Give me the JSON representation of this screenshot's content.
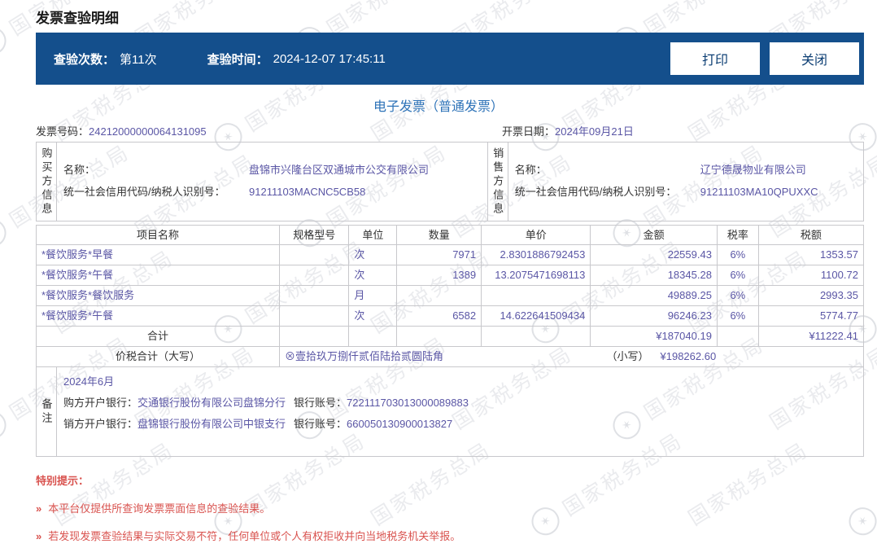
{
  "page_title": "发票查验明细",
  "query_bar": {
    "count_label": "查验次数：",
    "count_value": "第11次",
    "time_label": "查验时间：",
    "time_value": "2024-12-07 17:45:11",
    "print_button": "打印",
    "close_button": "关闭"
  },
  "invoice": {
    "type_title": "电子发票（普通发票）",
    "number_label": "发票号码：",
    "number": "24212000000064131095",
    "date_label": "开票日期：",
    "date": "2024年09月21日",
    "buyer": {
      "side_label": "购买方信息",
      "name_label": "名称：",
      "name": "盘锦市兴隆台区双通城市公交有限公司",
      "taxid_label": "统一社会信用代码/纳税人识别号：",
      "taxid": "91211103MACNC5CB58"
    },
    "seller": {
      "side_label": "销售方信息",
      "name_label": "名称：",
      "name": "辽宁德晟物业有限公司",
      "taxid_label": "统一社会信用代码/纳税人识别号：",
      "taxid": "91211103MA10QPUXXC"
    }
  },
  "items_table": {
    "headers": {
      "name": "项目名称",
      "spec": "规格型号",
      "unit": "单位",
      "qty": "数量",
      "price": "单价",
      "amount": "金额",
      "rate": "税率",
      "tax": "税额"
    },
    "rows": [
      {
        "name": "*餐饮服务*早餐",
        "spec": "",
        "unit": "次",
        "qty": "7971",
        "price": "2.8301886792453",
        "amount": "22559.43",
        "rate": "6%",
        "tax": "1353.57"
      },
      {
        "name": "*餐饮服务*午餐",
        "spec": "",
        "unit": "次",
        "qty": "1389",
        "price": "13.2075471698113",
        "amount": "18345.28",
        "rate": "6%",
        "tax": "1100.72"
      },
      {
        "name": "*餐饮服务*餐饮服务",
        "spec": "",
        "unit": "月",
        "qty": "",
        "price": "",
        "amount": "49889.25",
        "rate": "6%",
        "tax": "2993.35"
      },
      {
        "name": "*餐饮服务*午餐",
        "spec": "",
        "unit": "次",
        "qty": "6582",
        "price": "14.622641509434",
        "amount": "96246.23",
        "rate": "6%",
        "tax": "5774.77"
      }
    ],
    "total": {
      "label": "合计",
      "amount": "¥187040.19",
      "tax": "¥11222.41"
    },
    "tax_total": {
      "label": "价税合计（大写）",
      "uppercase": "⊗壹拾玖万捌仟贰佰陆拾贰圆陆角",
      "lowercase_label": "（小写）",
      "lowercase_value": "¥198262.60"
    },
    "remark": {
      "side_label": "备注",
      "line1": "2024年6月",
      "buyer_bank_label": "购方开户银行：",
      "buyer_bank": "交通银行股份有限公司盘锦分行",
      "buyer_acct_label": "银行账号：",
      "buyer_acct": "722111703013000089883",
      "seller_bank_label": "销方开户银行：",
      "seller_bank": "盘锦银行股份有限公司中银支行",
      "seller_acct_label": "银行账号：",
      "seller_acct": "660050130900013827"
    }
  },
  "notice": {
    "title": "特别提示：",
    "bullet": "»",
    "items": [
      "本平台仅提供所查询发票票面信息的查验结果。",
      "若发现发票查验结果与实际交易不符，任何单位或个人有权拒收并向当地税务机关举报。"
    ]
  },
  "watermark": {
    "text": "国家税务总局"
  },
  "colors": {
    "header_bar_blue": "#144f8c",
    "button_text_blue": "#0c3e73",
    "invoice_title_blue": "#2e73b8",
    "value_purple": "#5a56a5",
    "label_dark": "#333333",
    "notice_red": "#d9534f",
    "border_gray": "#c8c8cc"
  }
}
